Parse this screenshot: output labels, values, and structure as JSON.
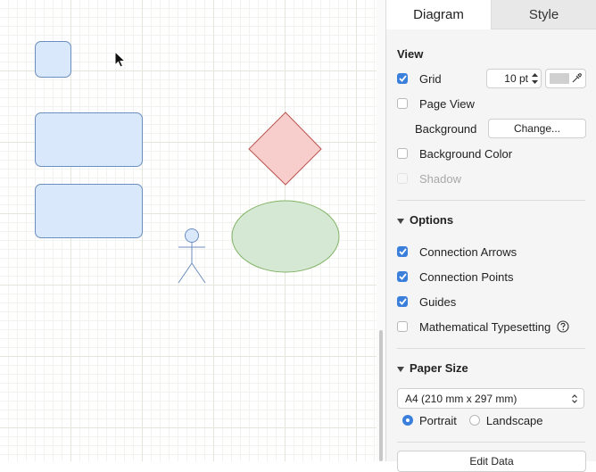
{
  "tabs": {
    "diagram": "Diagram",
    "style": "Style"
  },
  "view": {
    "title": "View",
    "grid": {
      "label": "Grid",
      "checked": true,
      "size_value": "10 pt",
      "color": "#d0d0d0"
    },
    "page_view": {
      "label": "Page View",
      "checked": false
    },
    "background": {
      "label": "Background",
      "button": "Change..."
    },
    "background_color": {
      "label": "Background Color",
      "checked": false
    },
    "shadow": {
      "label": "Shadow",
      "checked": false,
      "disabled": true
    }
  },
  "options": {
    "title": "Options",
    "connection_arrows": {
      "label": "Connection Arrows",
      "checked": true
    },
    "connection_points": {
      "label": "Connection Points",
      "checked": true
    },
    "guides": {
      "label": "Guides",
      "checked": true
    },
    "math": {
      "label": "Mathematical Typesetting",
      "checked": false
    }
  },
  "paper_size": {
    "title": "Paper Size",
    "selected": "A4 (210 mm x 297 mm)",
    "portrait": "Portrait",
    "landscape": "Landscape",
    "orientation": "portrait"
  },
  "edit_data_button": "Edit Data",
  "colors": {
    "accent": "#3b7fdd",
    "shape_blue_fill": "#dae8fc",
    "shape_blue_stroke": "#6c8ebf",
    "diamond_fill": "#f8cecc",
    "diamond_stroke": "#b85450",
    "ellipse_fill": "#d5e8d4",
    "ellipse_stroke": "#82b366"
  }
}
